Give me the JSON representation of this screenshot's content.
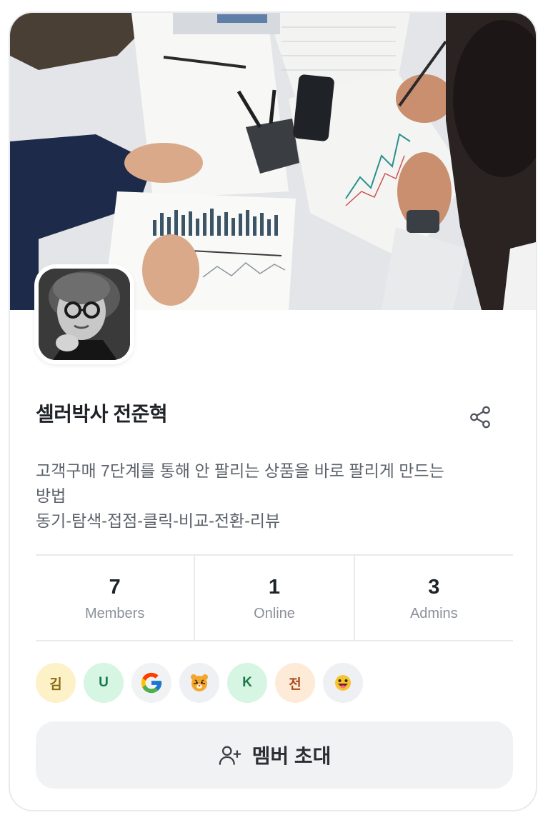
{
  "community": {
    "name": "셀러박사 전준혁",
    "description_lines": [
      "고객구매 7단계를 통해 안 팔리는 상품을 바로 팔리게 만드는",
      "방법",
      "동기-탐색-접점-클릭-비교-전환-리뷰"
    ]
  },
  "stats": [
    {
      "value": "7",
      "label": "Members"
    },
    {
      "value": "1",
      "label": "Online"
    },
    {
      "value": "3",
      "label": "Admins"
    }
  ],
  "members": [
    {
      "initial": "김",
      "bg": "#fdf1c8",
      "fg": "#8a6a12",
      "kind": "text"
    },
    {
      "initial": "U",
      "bg": "#d6f5e3",
      "fg": "#1a7a47",
      "kind": "text"
    },
    {
      "initial": "",
      "bg": "#f1f2f4",
      "fg": "",
      "kind": "google-icon"
    },
    {
      "initial": "",
      "bg": "#eef0f4",
      "fg": "",
      "kind": "tiger-emoji-icon"
    },
    {
      "initial": "K",
      "bg": "#d6f5e3",
      "fg": "#1a7a47",
      "kind": "text"
    },
    {
      "initial": "전",
      "bg": "#fdebd8",
      "fg": "#a84a1c",
      "kind": "text"
    },
    {
      "initial": "",
      "bg": "#eef0f4",
      "fg": "",
      "kind": "smile-emoji-icon"
    }
  ],
  "invite_button": {
    "label": "멤버 초대",
    "icon": "user-plus-icon"
  },
  "share_icon": "share-icon",
  "colors": {
    "border": "#e8eaee",
    "title": "#1f2328",
    "muted": "#8b9099",
    "button_bg": "#f1f2f4"
  }
}
